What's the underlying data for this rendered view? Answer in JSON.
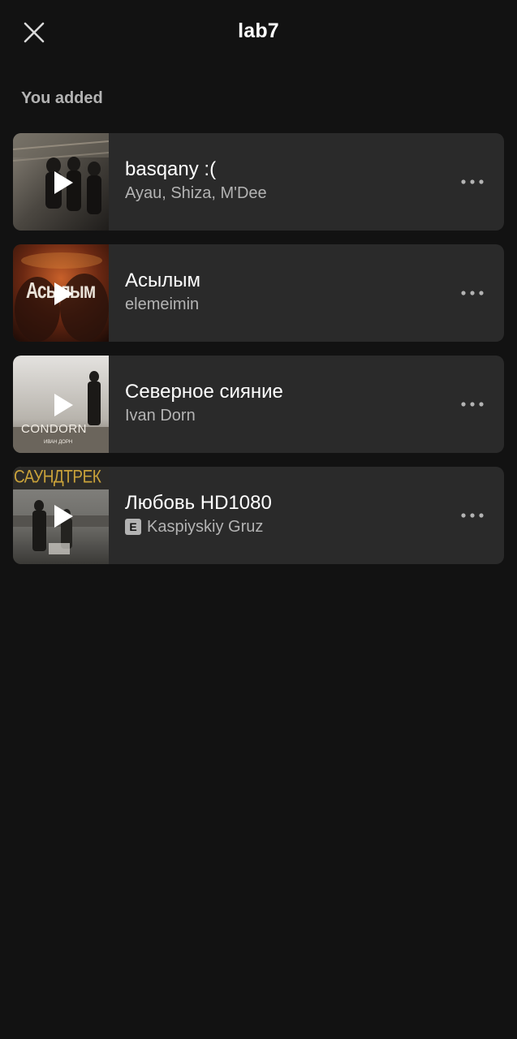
{
  "header": {
    "title": "lab7",
    "close_icon": "close-icon"
  },
  "section": {
    "label": "You added"
  },
  "tracks": [
    {
      "title": "basqany :(",
      "artist": "Ayau, Shiza, M'Dee",
      "explicit": false,
      "cover_text": ""
    },
    {
      "title": "Асылым",
      "artist": "elemeimin",
      "explicit": false,
      "cover_text": "Асылым"
    },
    {
      "title": "Северное сияние",
      "artist": "Ivan Dorn",
      "explicit": false,
      "cover_text": "CONDORN",
      "cover_subtext": "ИВАН ДОРН"
    },
    {
      "title": "Любовь HD1080",
      "artist": "Kaspiyskiy Gruz",
      "explicit": true,
      "explicit_label": "E",
      "cover_text": "САУНДТРЕК"
    }
  ],
  "colors": {
    "background": "#121212",
    "card": "#2a2a2a",
    "text_primary": "#ffffff",
    "text_secondary": "#b3b3b3"
  }
}
